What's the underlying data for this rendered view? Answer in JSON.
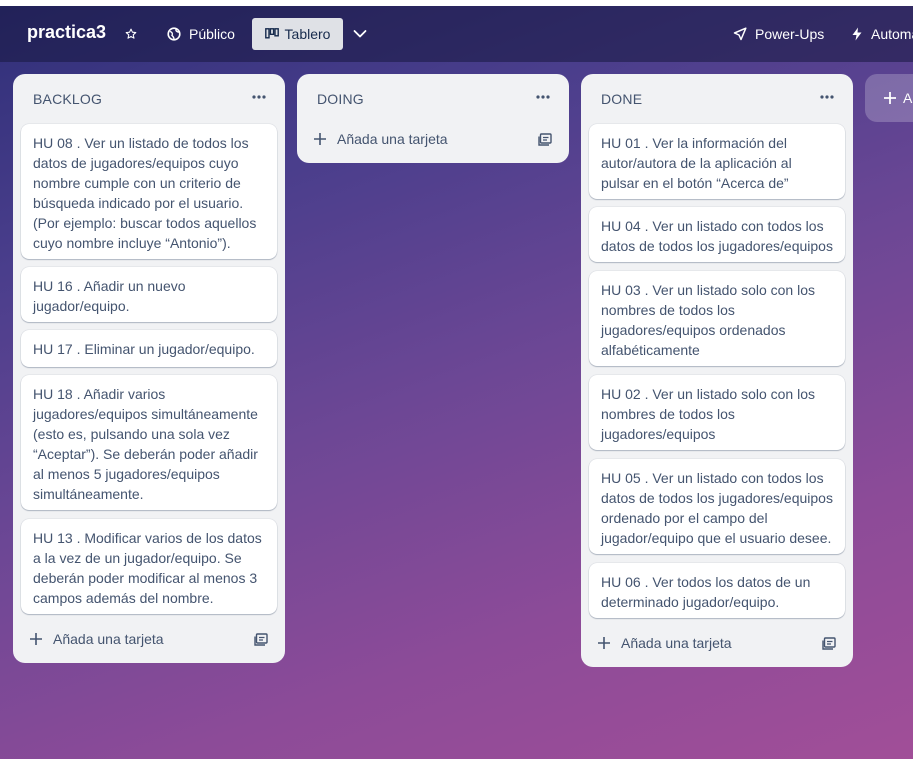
{
  "header": {
    "board_title": "practica3",
    "visibility_label": "Público",
    "view_label": "Tablero",
    "powerups_label": "Power-Ups",
    "automation_label": "Automa"
  },
  "lists": [
    {
      "title": "BACKLOG",
      "cards": [
        "HU 08 . Ver un listado de todos los datos de jugadores/equipos cuyo nombre cumple con un criterio de búsqueda indicado por el usuario. (Por ejemplo: buscar todos aquellos cuyo nombre incluye “Antonio”).",
        "HU 16 . Añadir un nuevo jugador/equipo.",
        "HU 17 . Eliminar un jugador/equipo.",
        "HU 18 . Añadir varios jugadores/equipos simultáneamente (esto es, pulsando una sola vez “Aceptar”). Se deberán poder añadir al menos 5 jugadores/equipos simultáneamente.",
        "HU 13 . Modificar varios de los datos a la vez de un jugador/equipo. Se deberán poder modificar al menos 3 campos además del nombre."
      ],
      "add_card_label": "Añada una tarjeta"
    },
    {
      "title": "DOING",
      "cards": [],
      "add_card_label": "Añada una tarjeta"
    },
    {
      "title": "DONE",
      "cards": [
        "HU 01 . Ver la información del autor/autora de la aplicación al pulsar en el botón “Acerca de”",
        "HU 04 . Ver un listado con todos los datos de todos los jugadores/equipos",
        "HU 03 . Ver un listado solo con los nombres de todos los jugadores/equipos ordenados alfabéticamente",
        "HU 02 . Ver un listado solo con los nombres de todos los jugadores/equipos",
        "HU 05 . Ver un listado con todos los datos de todos los jugadores/equipos ordenado por el campo del jugador/equipo que el usuario desee.",
        "HU 06 . Ver todos los datos de un determinado jugador/equipo."
      ],
      "add_card_label": "Añada una tarjeta"
    }
  ],
  "add_list_label": "A",
  "colors": {
    "topbar": "#2a2a5c",
    "list_bg": "#f1f2f4",
    "card_text": "#44546f",
    "tablero_bg": "#dfe1e6"
  }
}
